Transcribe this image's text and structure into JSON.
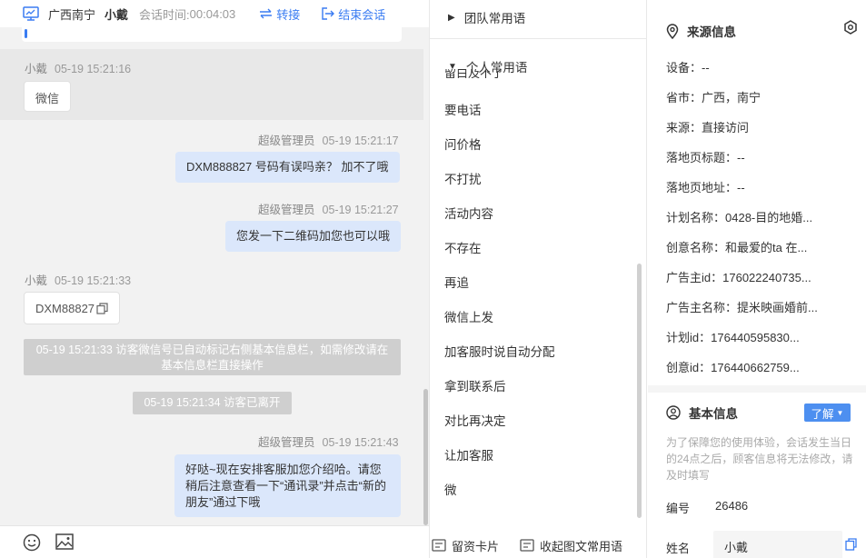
{
  "header": {
    "location": "广西南宁",
    "customer_name": "小戴",
    "time_label": "会话时间:",
    "time_value": "00:04:03",
    "transfer_label": "转接",
    "end_label": "结束会话"
  },
  "messages": [
    {
      "side": "left",
      "name": "小戴",
      "time": "05-19 15:21:16",
      "text": "微信"
    },
    {
      "side": "right",
      "name": "超级管理员",
      "time": "05-19 15:21:17",
      "text": "DXM888827  号码有误吗亲？ 加不了哦"
    },
    {
      "side": "right",
      "name": "超级管理员",
      "time": "05-19 15:21:27",
      "text": "您发一下二维码加您也可以哦"
    },
    {
      "side": "left",
      "name": "小戴",
      "time": "05-19 15:21:33",
      "text": "DXM88827"
    },
    {
      "side": "system",
      "text": "05-19 15:21:33 访客微信号已自动标记右侧基本信息栏，如需修改请在基本信息栏直接操作"
    },
    {
      "side": "system",
      "text": "05-19 15:21:34 访客已离开"
    },
    {
      "side": "right",
      "name": "超级管理员",
      "time": "05-19 15:21:43",
      "text": "好哒~现在安排客服加您介绍哈。请您稍后注意查看一下“通讯录”并点击“新的朋友”通过下哦"
    }
  ],
  "phrases": {
    "team_group": "团队常用语",
    "personal_group": "个人常用语",
    "cut_item": "留白及不了",
    "items": [
      "要电话",
      "问价格",
      "不打扰",
      "活动内容",
      "不存在",
      "再追",
      "微信上发",
      "加客服时说自动分配",
      "拿到联系后",
      "对比再决定",
      "让加客服",
      "微"
    ],
    "footer_card": "留资卡片",
    "footer_collapse": "收起图文常用语"
  },
  "source_info": {
    "title": "来源信息",
    "rows": [
      {
        "k": "设备：",
        "v": "--"
      },
      {
        "k": "省市：",
        "v": "广西，南宁"
      },
      {
        "k": "来源：",
        "v": "直接访问"
      },
      {
        "k": "落地页标题：",
        "v": "--"
      },
      {
        "k": "落地页地址：",
        "v": "--"
      },
      {
        "k": "计划名称：",
        "v": "0428-目的地婚..."
      },
      {
        "k": "创意名称：",
        "v": "和最爱的ta 在..."
      },
      {
        "k": "广告主id：",
        "v": "176022240735..."
      },
      {
        "k": "广告主名称：",
        "v": "提米映画婚前..."
      },
      {
        "k": "计划id：",
        "v": "176440595830..."
      },
      {
        "k": "创意id：",
        "v": "176440662759..."
      }
    ]
  },
  "basic_info": {
    "title": "基本信息",
    "learn_label": "了解",
    "note": "为了保障您的使用体验，会话发生当日的24点之后，顾客信息将无法修改，请及时填写",
    "id_label": "编号",
    "id_value": "26486",
    "name_label": "姓名",
    "name_value": "小戴"
  },
  "colors": {
    "accent": "#3a7cf2",
    "bubble_right": "#dbe7fb",
    "system": "#cfcfcf",
    "learn": "#4d8ff0"
  }
}
